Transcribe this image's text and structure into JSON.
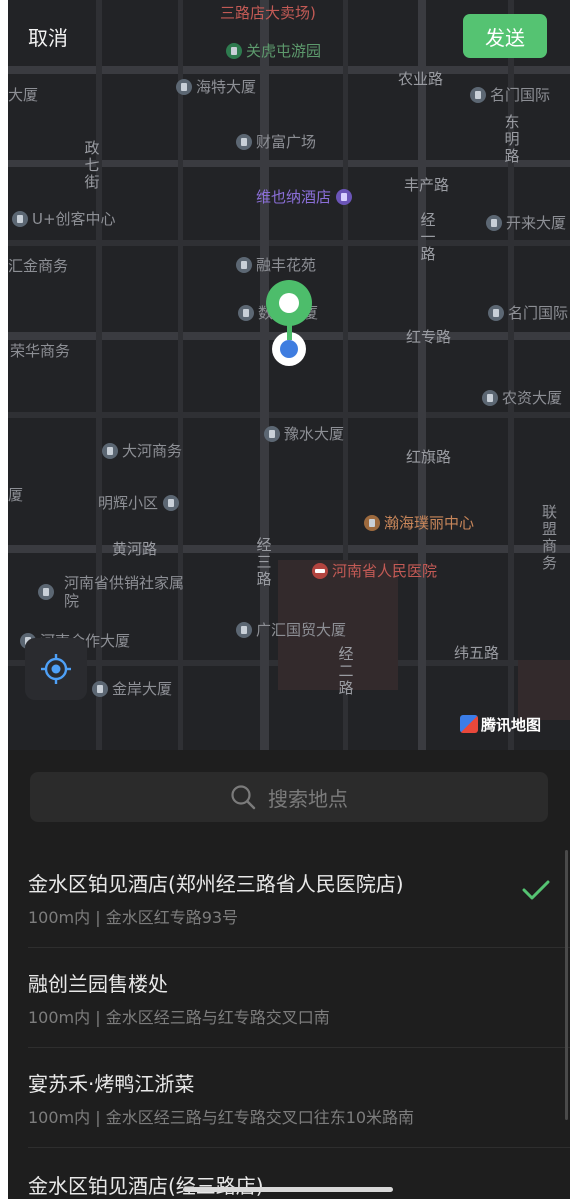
{
  "header": {
    "cancel_label": "取消",
    "send_label": "发送"
  },
  "map": {
    "labels": {
      "top_partial": "三路店大卖场)",
      "guanhutun": "关虎屯游园",
      "nongye_lu": "农业路",
      "hainan_dasha": "海特大厦",
      "mingmen_guoji": "名门国际",
      "dasha_left": "大厦",
      "zhengqi_jie": "政七街",
      "dongming_lu": "东明路",
      "caifu_guangchang": "财富广场",
      "fengchan_lu": "丰产路",
      "weiyena_hotel": "维也纳酒店",
      "uplus": "U+创客中心",
      "kailai_dasha": "开来大厦",
      "jing_yi_lu": "经一路",
      "huijin_shangwu": "汇金商务",
      "rongfeng_huayuan": "融丰花苑",
      "shuma_dasha": "数码大厦",
      "mingmen_guoji_2": "名门国际",
      "hongzhuan_lu": "红专路",
      "ronghua_shangwu": "荣华商务",
      "nongzi_dasha": "农资大厦",
      "yushui_dasha": "豫水大厦",
      "dahe_shangwu": "大河商务",
      "hongqi_lu": "红旗路",
      "sha_left": "厦",
      "minghui_xiaoqu": "明辉小区",
      "hanhai_center": "瀚海璞丽中心",
      "lianmeng_shangwu": "联盟商务",
      "huanghe_lu": "黄河路",
      "jing_san_lu": "经三路",
      "henan_hospital": "河南省人民医院",
      "henan_gongxiao": "河南省供销社家属院",
      "henan_hezuo": "河南合作大厦",
      "guanghui_dasha": "广汇国贸大厦",
      "weiwu_lu": "纬五路",
      "jing_er_lu": "经二路",
      "jinan_dasha": "金岸大厦"
    },
    "brand": "腾讯地图"
  },
  "search": {
    "placeholder": "搜索地点"
  },
  "results": [
    {
      "title": "金水区铂见酒店(郑州经三路省人民医院店)",
      "subtitle": "100m内 | 金水区红专路93号",
      "selected": true
    },
    {
      "title": "融创兰园售楼处",
      "subtitle": "100m内 | 金水区经三路与红专路交叉口南",
      "selected": false
    },
    {
      "title": "宴苏禾·烤鸭江浙菜",
      "subtitle": "100m内 | 金水区经三路与红专路交叉口往东10米路南",
      "selected": false
    },
    {
      "title": "金水区铂见酒店(经三路店)",
      "subtitle": "",
      "selected": false
    }
  ],
  "colors": {
    "accent_green": "#55c372",
    "map_bg": "#222326",
    "sheet_bg": "#1e1e1e",
    "location_blue": "#3f7de0"
  }
}
